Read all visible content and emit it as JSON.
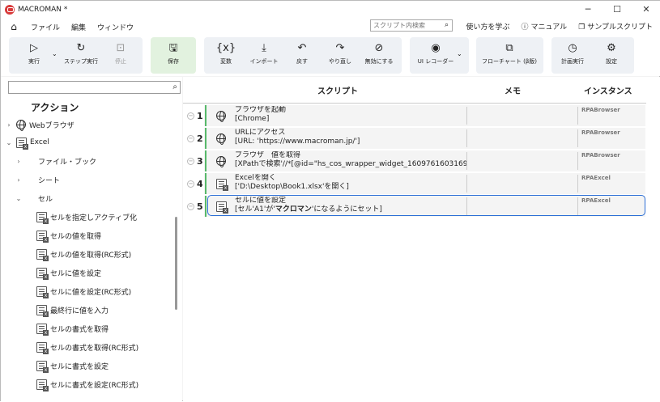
{
  "window": {
    "title": "MACROMAN *",
    "controls": [
      "─",
      "☐",
      "✕"
    ]
  },
  "menu": {
    "items": [
      "ファイル",
      "編集",
      "ウィンドウ"
    ],
    "search_placeholder": "スクリプト内検索",
    "links": [
      "使い方を学ぶ",
      "マニュアル",
      "サンプルスクリプト"
    ]
  },
  "toolbar": {
    "run": "実行",
    "step": "ステップ実行",
    "stop": "停止",
    "save": "保存",
    "variable": "変数",
    "import": "インポート",
    "undo": "戻す",
    "redo": "やり直し",
    "disable": "無効にする",
    "ui_recorder": "UI レコーダー",
    "flowchart": "フローチャート (β版)",
    "schedule": "計画実行",
    "settings": "設定"
  },
  "left": {
    "heading": "アクション",
    "tree": [
      {
        "label": "Webブラウザ",
        "level": 0,
        "arrow": "›",
        "icon": "globe-icon"
      },
      {
        "label": "Excel",
        "level": 0,
        "arrow": "⌄",
        "icon": "excel-icon"
      },
      {
        "label": "ファイル・ブック",
        "level": 1,
        "arrow": "›"
      },
      {
        "label": "シート",
        "level": 1,
        "arrow": "›"
      },
      {
        "label": "セル",
        "level": 1,
        "arrow": "⌄"
      },
      {
        "label": "セルを指定しアクティブ化",
        "level": 2,
        "icon": "excel-icon"
      },
      {
        "label": "セルの値を取得",
        "level": 2,
        "icon": "excel-icon"
      },
      {
        "label": "セルの値を取得(RC形式)",
        "level": 2,
        "icon": "excel-icon"
      },
      {
        "label": "セルに値を設定",
        "level": 2,
        "icon": "excel-icon"
      },
      {
        "label": "セルに値を設定(RC形式)",
        "level": 2,
        "icon": "excel-icon"
      },
      {
        "label": "最終行に値を入力",
        "level": 2,
        "icon": "excel-icon"
      },
      {
        "label": "セルの書式を取得",
        "level": 2,
        "icon": "excel-icon"
      },
      {
        "label": "セルの書式を取得(RC形式)",
        "level": 2,
        "icon": "excel-icon"
      },
      {
        "label": "セルに書式を設定",
        "level": 2,
        "icon": "excel-icon"
      },
      {
        "label": "セルに書式を設定(RC形式)",
        "level": 2,
        "icon": "excel-icon"
      }
    ]
  },
  "script": {
    "headers": {
      "script": "スクリプト",
      "memo": "メモ",
      "instance": "インスタンス"
    },
    "rows": [
      {
        "num": "1",
        "icon": "globe-icon",
        "line1": "ブラウザを起動",
        "line2": "[Chrome]",
        "instance": "RPABrowser"
      },
      {
        "num": "2",
        "icon": "globe-icon",
        "line1": "URLにアクセス",
        "line2": "[URL: 'https://www.macroman.jp/']",
        "instance": "RPABrowser"
      },
      {
        "num": "3",
        "icon": "globe-icon",
        "line1": "ブラウザ　値を取得",
        "line2": "[XPathで検索'//*[@id=\"hs_cos_wrapper_widget_1609761603169",
        "instance": "RPABrowser"
      },
      {
        "num": "4",
        "icon": "excel-icon",
        "line1": "Excelを開く",
        "line2": "['D:\\Desktop\\Book1.xlsx'を開く]",
        "instance": "RPAExcel"
      },
      {
        "num": "5",
        "icon": "excel-icon",
        "line1": "セルに値を設定",
        "line2_a": "[セル'A1'が'",
        "line2_b": "マクロマン",
        "line2_c": "'になるようにセット]",
        "instance": "RPAExcel"
      }
    ]
  }
}
